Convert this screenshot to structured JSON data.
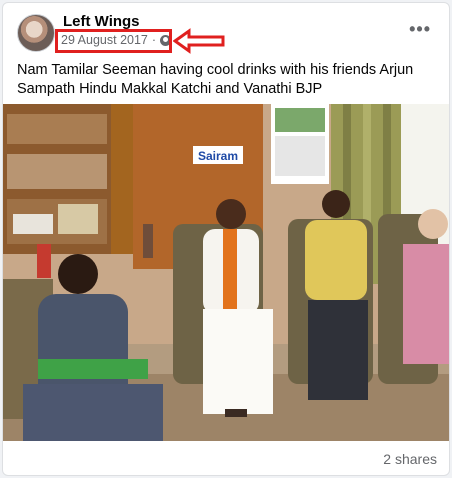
{
  "post": {
    "author": "Left Wings",
    "date": "29 August 2017",
    "privacy_icon": "globe-icon",
    "more_icon": "more-options-icon",
    "text": "Nam Tamilar Seeman having cool drinks with his friends Arjun Sampath Hindu Makkal Katchi and Vanathi  BJP",
    "image_sign": "Sairam",
    "shares": "2 shares"
  },
  "annotation": {
    "box_color": "#e0201f",
    "arrow_color": "#e0201f"
  }
}
